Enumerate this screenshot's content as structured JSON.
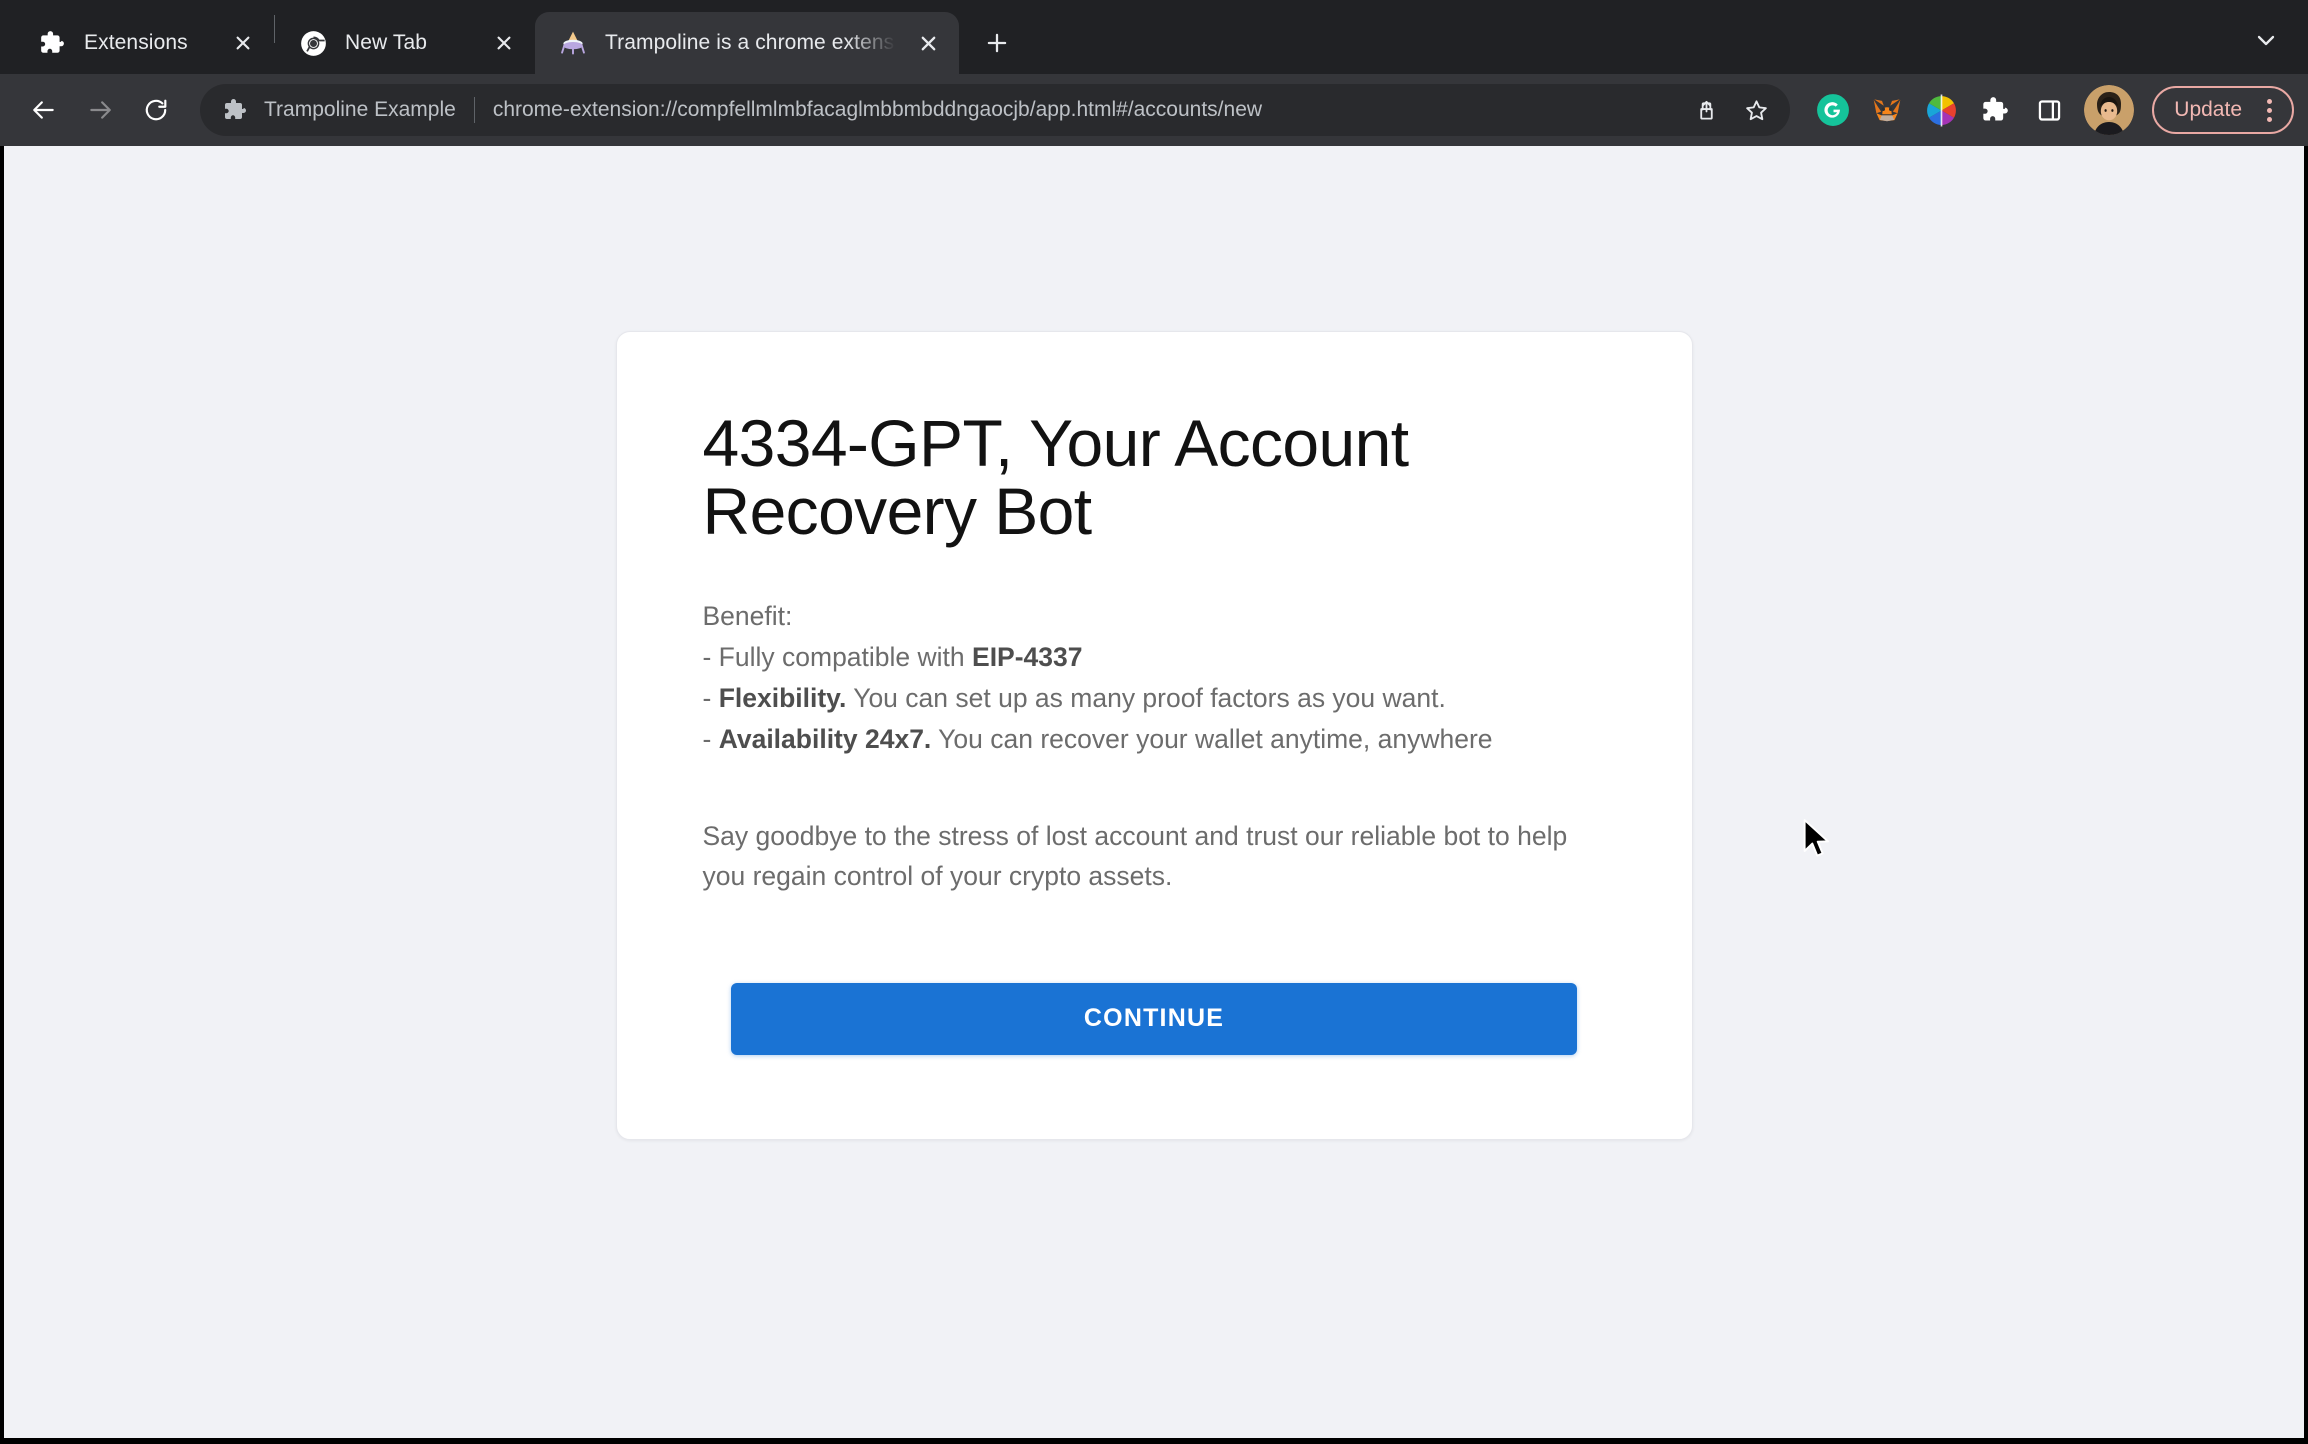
{
  "browser": {
    "tabs": [
      {
        "title": "Extensions",
        "favicon": "puzzle-piece-icon",
        "active": false,
        "close_label": "✕"
      },
      {
        "title": "New Tab",
        "favicon": "chrome-icon",
        "active": false,
        "close_label": "✕"
      },
      {
        "title": "Trampoline is a chrome extensi",
        "favicon": "trampoline-icon",
        "active": true,
        "close_label": "✕"
      }
    ],
    "new_tab_label": "+",
    "tab_search_icon": "chevron-down-icon",
    "toolbar": {
      "back_icon": "back-arrow-icon",
      "forward_icon": "forward-arrow-icon",
      "reload_icon": "reload-icon",
      "omnibox": {
        "extension_icon": "puzzle-piece-icon",
        "chip_label": "Trampoline Example",
        "url": "chrome-extension://compfellmlmbfacaglmbbmbddngaocjb/app.html#/accounts/new",
        "share_icon": "share-icon",
        "bookmark_icon": "star-outline-icon"
      },
      "extension_buttons": [
        {
          "name": "grammarly-extension-icon",
          "label": "G",
          "color": "#15c39a"
        },
        {
          "name": "metamask-extension-icon",
          "label": "",
          "color": "#e2761b"
        },
        {
          "name": "color-wheel-extension-icon",
          "label": "",
          "color": "#d83b3b"
        },
        {
          "name": "extensions-puzzle-icon",
          "label": "",
          "color": "#ffffff"
        },
        {
          "name": "side-panel-icon",
          "label": "",
          "color": "#ffffff"
        }
      ],
      "avatar": "user-avatar",
      "update_label": "Update",
      "menu_icon": "three-dot-menu-icon"
    }
  },
  "page": {
    "title": "4334-GPT, Your Account Recovery Bot",
    "benefit_heading": "Benefit:",
    "benefits": [
      {
        "prefix": "- Fully compatible with ",
        "bold": "EIP-4337",
        "suffix": ""
      },
      {
        "prefix": "- ",
        "bold": "Flexibility.",
        "suffix": " You can set up as many proof factors as you want."
      },
      {
        "prefix": "- ",
        "bold": "Availability 24x7.",
        "suffix": " You can recover your wallet anytime, anywhere"
      }
    ],
    "tagline": "Say goodbye to the stress of lost account and trust our reliable bot to help you regain control of your crypto assets.",
    "continue_label": "CONTINUE",
    "colors": {
      "page_background": "#f1f2f6",
      "card_background": "#ffffff",
      "primary_button": "#1a73d4",
      "body_text": "#6c6c6c",
      "heading_text": "#121212"
    }
  }
}
